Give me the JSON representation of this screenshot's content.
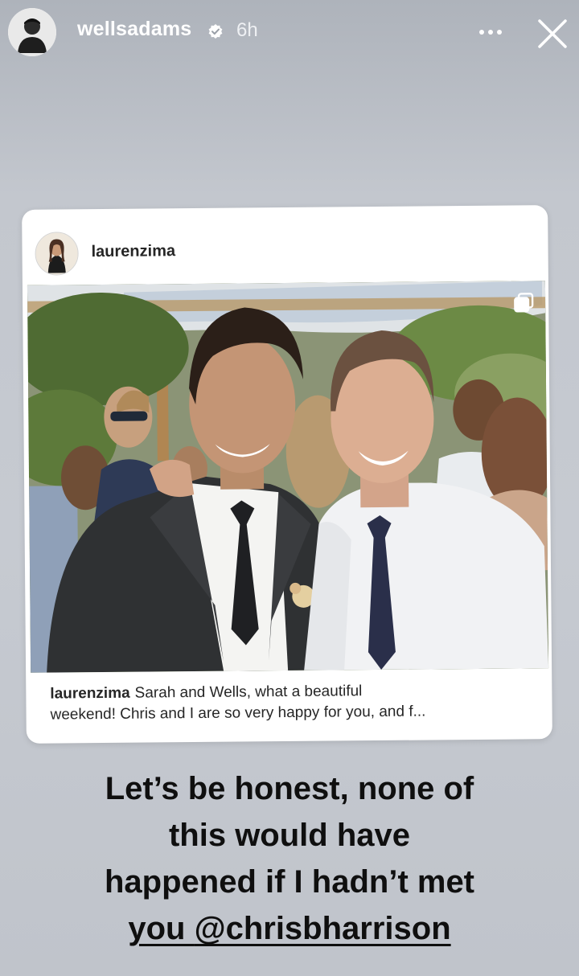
{
  "header": {
    "username": "wellsadams",
    "time_ago": "6h",
    "avatar_icon": "profile-avatar",
    "verified_icon": "verified-badge-icon",
    "more_icon": "more-options-icon",
    "close_icon": "close-icon"
  },
  "shared_post": {
    "username": "laurenzima",
    "caption_user": "laurenzima",
    "caption_line1": "Sarah and Wells, what a beautiful",
    "caption_line2": "weekend! Chris and I are so very happy for you, and f...",
    "multi_photo_icon": "carousel-icon"
  },
  "story_text": {
    "line1": "Let’s be honest, none of",
    "line2": "this would have",
    "line3": "happened if I hadn’t met",
    "line4_prefix": "you ",
    "mention": "@chrisbharrison"
  },
  "colors": {
    "background": "#c3c7ce",
    "card": "#ffffff",
    "text_dark": "#0f0f0f",
    "header_text": "#ffffff"
  }
}
